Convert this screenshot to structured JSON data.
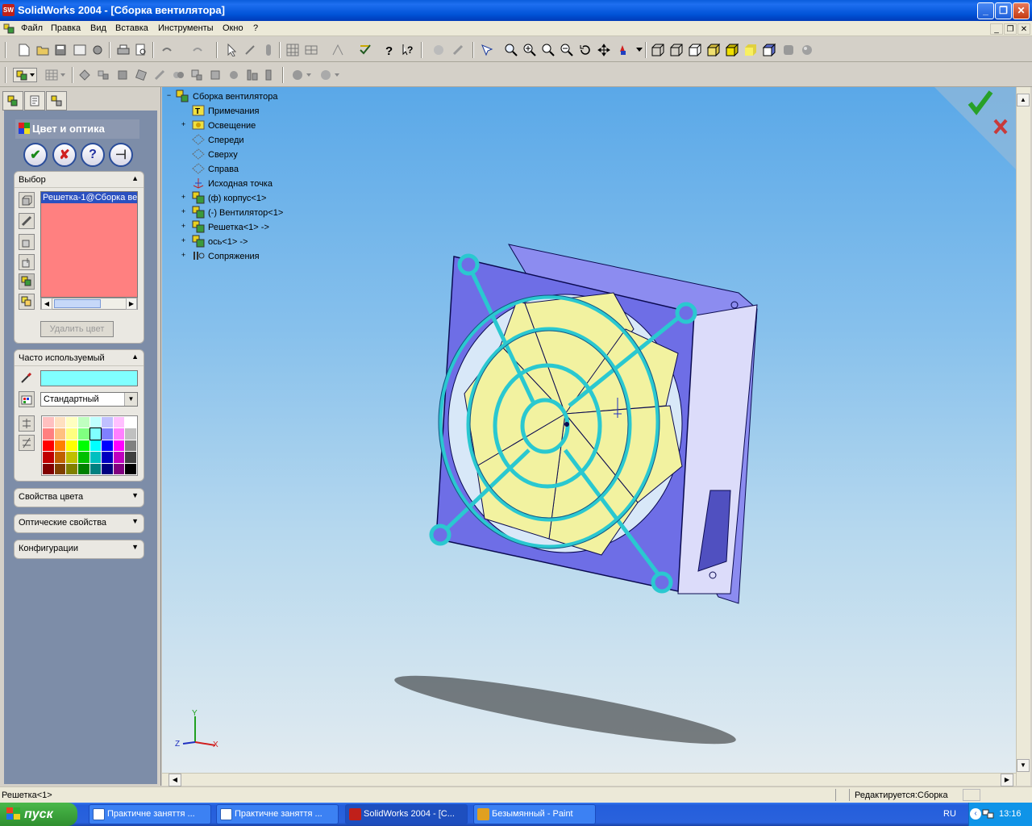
{
  "window": {
    "app_icon": "SW",
    "title": "SolidWorks 2004 - [Сборка вентилятора]",
    "minimize": "_",
    "restore": "❐",
    "close": "✕"
  },
  "menu": [
    "Файл",
    "Правка",
    "Вид",
    "Вставка",
    "Инструменты",
    "Окно",
    "?"
  ],
  "mdi": {
    "minimize": "_",
    "restore": "❐",
    "close": "✕"
  },
  "property_manager": {
    "title": "Цвет и оптика",
    "ok_label": "✔",
    "cancel_label": "✘",
    "help_label": "?",
    "pin_label": "⊣",
    "selection": {
      "header": "Выбор",
      "item": "Решетка-1@Сборка ве",
      "remove_color": "Удалить цвет"
    },
    "frequent": {
      "header": "Часто используемый",
      "palette_dropdown": "Стандартный"
    },
    "color_properties": "Свойства цвета",
    "optical_properties": "Оптические свойства",
    "configurations": "Конфигурации",
    "palette_colors": [
      "#ffc0c0",
      "#ffe0c0",
      "#ffffc0",
      "#c0ffc0",
      "#c0ffff",
      "#c0c0ff",
      "#ffc0ff",
      "#ffffff",
      "#ff8080",
      "#ffc080",
      "#ffff80",
      "#80ff80",
      "#80ffff",
      "#8080ff",
      "#ff80ff",
      "#c0c0c0",
      "#ff0000",
      "#ff8000",
      "#ffff00",
      "#00ff00",
      "#00ffff",
      "#0000ff",
      "#ff00ff",
      "#808080",
      "#c00000",
      "#c06000",
      "#c0c000",
      "#00c000",
      "#00c0c0",
      "#0000c0",
      "#c000c0",
      "#404040",
      "#800000",
      "#804000",
      "#808000",
      "#008000",
      "#008080",
      "#000080",
      "#800080",
      "#000000"
    ]
  },
  "tree": [
    {
      "label": "Сборка вентилятора",
      "expand": "−",
      "icon": "assembly-icon"
    },
    {
      "label": "Примечания",
      "expand": "",
      "icon": "annotations-icon"
    },
    {
      "label": "Освещение",
      "expand": "+",
      "icon": "lighting-icon"
    },
    {
      "label": "Спереди",
      "expand": "",
      "icon": "plane-icon"
    },
    {
      "label": "Сверху",
      "expand": "",
      "icon": "plane-icon"
    },
    {
      "label": "Справа",
      "expand": "",
      "icon": "plane-icon"
    },
    {
      "label": "Исходная точка",
      "expand": "",
      "icon": "origin-icon"
    },
    {
      "label": "(ф) корпус<1>",
      "expand": "+",
      "icon": "part-icon"
    },
    {
      "label": "(-) Вентилятор<1>",
      "expand": "+",
      "icon": "part-icon"
    },
    {
      "label": "Решетка<1> ->",
      "expand": "+",
      "icon": "part-icon"
    },
    {
      "label": "ось<1> ->",
      "expand": "+",
      "icon": "part-icon"
    },
    {
      "label": "Сопряжения",
      "expand": "+",
      "icon": "mates-icon"
    }
  ],
  "triad": {
    "x": "X",
    "y": "Y",
    "z": "Z"
  },
  "status": {
    "left": "Решетка<1>",
    "right": "Редактируется:Сборка"
  },
  "taskbar": {
    "start": "пуск",
    "tasks": [
      {
        "label": "Практичне заняття ...",
        "color": "#2b5fb8"
      },
      {
        "label": "Практичне заняття ...",
        "color": "#2b5fb8"
      },
      {
        "label": "SolidWorks 2004 - [С...",
        "color": "#c0201a"
      },
      {
        "label": "Безымянный - Paint",
        "color": "#e0a020"
      }
    ],
    "lang": "RU",
    "clock": "13:16"
  }
}
